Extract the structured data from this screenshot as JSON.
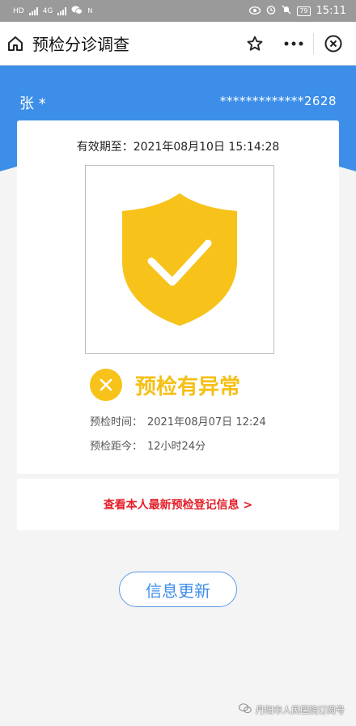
{
  "statusbar": {
    "left_labels": [
      "HD",
      "HD",
      "4G",
      "4G"
    ],
    "battery": "79",
    "time": "15:11"
  },
  "nav": {
    "title": "预检分诊调查",
    "icons": [
      "home-icon",
      "star-icon",
      "more-icon",
      "close-icon"
    ]
  },
  "user": {
    "name": "张 *",
    "id": "*************2628"
  },
  "card": {
    "valid_until": "有效期至：2021年08月10日 15:14:28",
    "status": "预检有异常",
    "check_time_label": "预检时间：",
    "check_time_value": "2021年08月07日 12:24",
    "elapsed_label": "预检距今：",
    "elapsed_value": "12小时24分"
  },
  "link": {
    "text": "查看本人最新预检登记信息 >"
  },
  "refresh": {
    "label": "信息更新"
  },
  "watermark": {
    "text": "丹阳市人民医院订阅号"
  },
  "colors": {
    "brand_blue": "#3d8ee8",
    "shield_yellow": "#f7c21a",
    "link_red": "#e4202a"
  }
}
